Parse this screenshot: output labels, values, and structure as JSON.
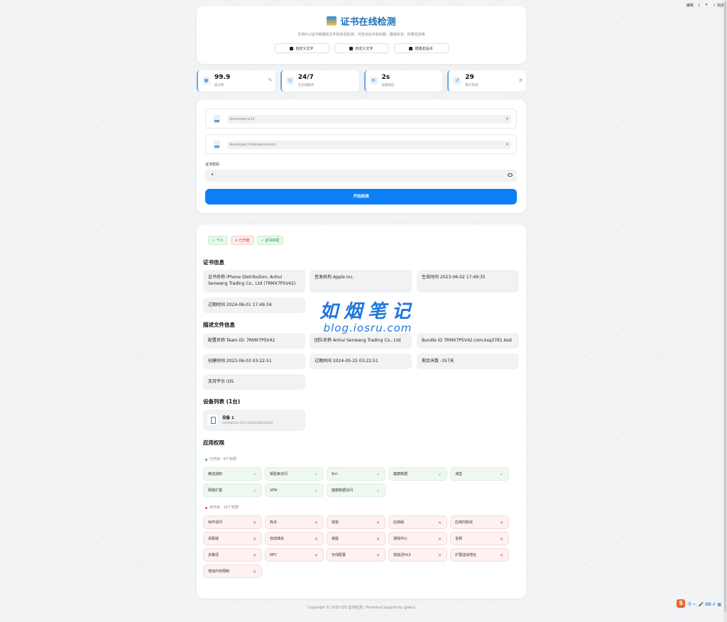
{
  "topbar": {
    "edit": "编辑",
    "done": "完成"
  },
  "header": {
    "title": "证书在线检测",
    "subtitle": "支持P12证书和描述文件的状态检测，可查询证书有效期、撤销状态、权限信息等",
    "buttons": [
      "自定义文字",
      "自定义文字",
      "搭建此站点"
    ]
  },
  "stats": [
    {
      "value": "99.9",
      "label": "成功率",
      "unit": "%"
    },
    {
      "value": "24/7",
      "label": "全天候服务",
      "unit": ""
    },
    {
      "value": "2s",
      "label": "快速响应",
      "unit": ""
    },
    {
      "value": "29",
      "label": "累计检测",
      "unit": "次"
    }
  ],
  "upload": {
    "p12_file": "developer.p12",
    "profile_file": "developer.mobileprovision",
    "password_label": "证书密码",
    "password_value": "•",
    "start_button": "开始检测",
    "clear_symbol": "×"
  },
  "badges": [
    {
      "text": "✓ 个人",
      "type": "green"
    },
    {
      "text": "✕ 已作废",
      "type": "red"
    },
    {
      "text": "✓ 证书匹配",
      "type": "green"
    }
  ],
  "cert_info": {
    "title": "证书信息",
    "name": "证书名称 iPhone Distribution: Anhui Senwang Trading Co., Ltd (7RMX7P5V42)",
    "issuer": "签发机构 Apple Inc.",
    "effective": "生效时间 2023-06-02 17:49:35",
    "expires": "过期时间 2024-06-01 17:49:34"
  },
  "profile_info": {
    "title": "描述文件信息",
    "team_id": "配置名称 Team ID: 7RMX7P5V42",
    "team_name": "团队名称 Anhui Senwang Trading Co., Ltd",
    "bundle_id": "Bundle ID 7RMX7P5V42.com.ksq3781.test",
    "created": "创建时间 2023-06-03 03:22:51",
    "expires": "过期时间 2024-05-25 03:22:51",
    "remaining": "剩余天数 -357天",
    "platform": "支持平台 iOS"
  },
  "devices": {
    "title": "设备列表 (1台)",
    "items": [
      {
        "name": "设备 1",
        "udid": "00008030-001C64D434DA402E"
      }
    ]
  },
  "permissions": {
    "title": "应用权限",
    "enabled_label": "已开启 · 8个权限",
    "disabled_label": "未开启 · 16个权限",
    "check": "✓",
    "cross": "✕",
    "enabled": [
      "推送通知",
      "钥匙串访问",
      "Siri",
      "健康数据",
      "课堂",
      "网络扩展",
      "VPN",
      "健康数据访问"
    ],
    "disabled": [
      "WiFi访问",
      "热点",
      "钱包",
      "应用组",
      "应用内购买",
      "关联域",
      "自动填充",
      "家庭",
      "游戏中心",
      "音频",
      "多路径",
      "NFC",
      "无线配置",
      "低延迟HLS",
      "扩展虚拟地址",
      "增加内存限制"
    ]
  },
  "watermark": {
    "big": "如烟笔记",
    "small": "blog.iosru.com"
  },
  "footer": "Copyright © 2025 iOS 证书检测 | Technical Support by @ahui",
  "tray": {
    "logo": "S",
    "items": "中 •, 🎤 ⌨ ✔ ▦"
  },
  "colors": {
    "accent": "#0d7ff7",
    "success": "#3fae5a",
    "danger": "#e05252"
  }
}
